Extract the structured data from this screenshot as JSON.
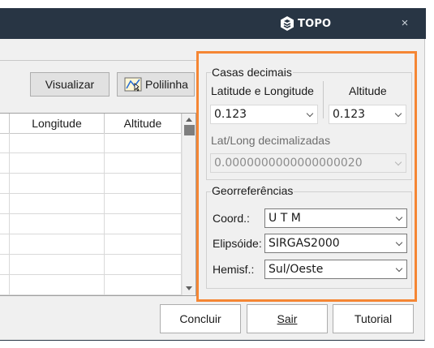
{
  "app": {
    "logo_text": "TOPO",
    "close_glyph": "×"
  },
  "toolbar": {
    "visualizar_label": "Visualizar",
    "polilinha_label": "Polilinha"
  },
  "grid": {
    "columns": [
      "Longitude",
      "Altitude"
    ],
    "row_count": 8
  },
  "casas": {
    "group_label": "Casas decimais",
    "latlong_label": "Latitude e Longitude",
    "altitude_label": "Altitude",
    "latlong_value": "0.123",
    "altitude_value": "0.123",
    "decimalizadas_label": "Lat/Long decimalizadas",
    "decimalizadas_value": "0.0000000000000000020"
  },
  "georef": {
    "group_label": "Georreferências",
    "coord_label": "Coord.:",
    "coord_value": "U T M",
    "elipsoide_label": "Elipsóide:",
    "elipsoide_value": "SIRGAS2000",
    "hemisf_label": "Hemisf.:",
    "hemisf_value": "Sul/Oeste"
  },
  "footer": {
    "concluir_label": "Concluir",
    "sair_label": "Sair",
    "tutorial_label": "Tutorial"
  },
  "colors": {
    "titlebar": "#283544",
    "highlight": "#f58634",
    "window_bg": "#f0f0f0"
  }
}
